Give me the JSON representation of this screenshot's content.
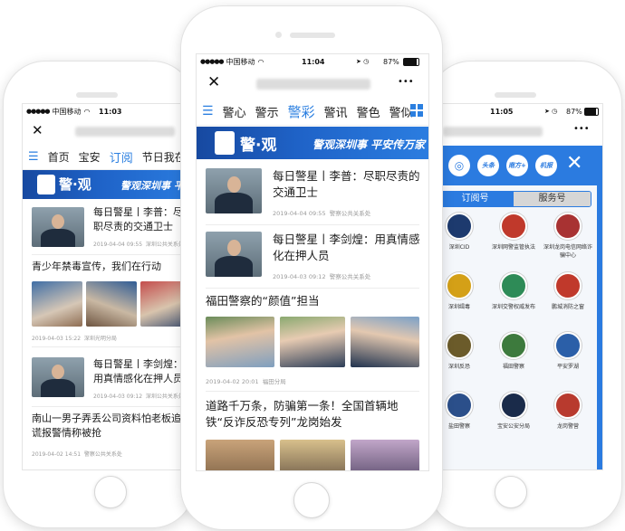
{
  "left_phone": {
    "status": {
      "carrier": "中国移动",
      "time": "11:03"
    },
    "nav": {
      "close_label": "✕"
    },
    "tabs": [
      "首页",
      "宝安",
      "订阅",
      "节日我在岗"
    ],
    "active_tab_index": 2,
    "banner": {
      "logo_text": "警·观",
      "slogan": "警观深圳事 平"
    },
    "articles": [
      {
        "title": "每日警星丨李普：尽职尽责的交通卫士",
        "date": "2019-04-04 09:55",
        "source": "深圳公共关系处"
      },
      {
        "title": "青少年禁毒宣传，我们在行动",
        "date": "2019-04-03 15:22",
        "source": "深圳光明分局"
      },
      {
        "title": "每日警星丨李剑煌：用真情感化在押人员",
        "date": "2019-04-03 09:12",
        "source": "深圳公共关系处"
      },
      {
        "title": "南山一男子弄丢公司资料怕老板追责 谎报警情称被抢",
        "date": "2019-04-02 14:51",
        "source": "警察公共关系处"
      }
    ]
  },
  "center_phone": {
    "status": {
      "carrier": "中国移动",
      "time": "11:04",
      "battery": "87%"
    },
    "nav": {
      "close_label": "✕",
      "more_label": "•••"
    },
    "tabs": [
      "警心",
      "警示",
      "警彩",
      "警讯",
      "警色",
      "警似"
    ],
    "active_tab_index": 2,
    "banner": {
      "logo_text": "警·观",
      "slogan": "警观深圳事 平安传万家"
    },
    "articles": [
      {
        "title": "每日警星丨李普：尽职尽责的交通卫士",
        "date": "2019-04-04 09:55",
        "source": "警察公共关系处"
      },
      {
        "title": "每日警星丨李剑煌：用真情感化在押人员",
        "date": "2019-04-03 09:12",
        "source": "警察公共关系处"
      },
      {
        "title": "福田警察的“颜值”担当",
        "date": "2019-04-02 20:01",
        "source": "福田分局"
      },
      {
        "title": "道路千万条，防骗第一条！全国首辆地铁“反诈反恐专列”龙岗始发",
        "date": "",
        "source": ""
      }
    ]
  },
  "right_phone": {
    "status": {
      "time": "11:05",
      "battery": "87%"
    },
    "nav": {
      "more_label": "•••"
    },
    "top_icons": [
      "头条",
      "南方+",
      "机报"
    ],
    "close_label": "✕",
    "segments": [
      "订阅号",
      "服务号"
    ],
    "accounts": [
      {
        "name": "深圳CID",
        "color": "#1d3a6e"
      },
      {
        "name": "深圳网警监管执法",
        "color": "#c0392b"
      },
      {
        "name": "深圳龙岗电信网络诈骗中心",
        "color": "#a83232"
      },
      {
        "name": "深圳缉毒",
        "color": "#d4a017"
      },
      {
        "name": "深圳交警权威发布",
        "color": "#2e8b57"
      },
      {
        "name": "鹏城消防之窗",
        "color": "#c0392b"
      },
      {
        "name": "深圳反恐",
        "color": "#6b5b2a"
      },
      {
        "name": "福田警察",
        "color": "#3d7a3d"
      },
      {
        "name": "平安罗湖",
        "color": "#2b5fa8"
      },
      {
        "name": "盐田警察",
        "color": "#2b4f8a"
      },
      {
        "name": "宝安公安分局",
        "color": "#1a2b4a"
      },
      {
        "name": "龙岗警营",
        "color": "#b83a2e"
      }
    ]
  }
}
